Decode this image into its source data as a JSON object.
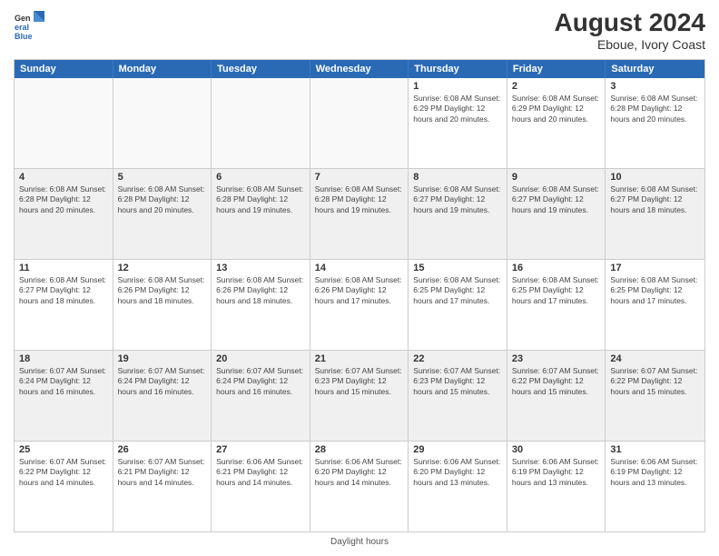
{
  "header": {
    "logo": {
      "general": "General",
      "blue": "Blue"
    },
    "title": "August 2024",
    "subtitle": "Eboue, Ivory Coast"
  },
  "calendar": {
    "days_of_week": [
      "Sunday",
      "Monday",
      "Tuesday",
      "Wednesday",
      "Thursday",
      "Friday",
      "Saturday"
    ],
    "weeks": [
      [
        {
          "day": "",
          "detail": "",
          "empty": true
        },
        {
          "day": "",
          "detail": "",
          "empty": true
        },
        {
          "day": "",
          "detail": "",
          "empty": true
        },
        {
          "day": "",
          "detail": "",
          "empty": true
        },
        {
          "day": "1",
          "detail": "Sunrise: 6:08 AM\nSunset: 6:29 PM\nDaylight: 12 hours\nand 20 minutes.",
          "empty": false
        },
        {
          "day": "2",
          "detail": "Sunrise: 6:08 AM\nSunset: 6:29 PM\nDaylight: 12 hours\nand 20 minutes.",
          "empty": false
        },
        {
          "day": "3",
          "detail": "Sunrise: 6:08 AM\nSunset: 6:28 PM\nDaylight: 12 hours\nand 20 minutes.",
          "empty": false
        }
      ],
      [
        {
          "day": "4",
          "detail": "Sunrise: 6:08 AM\nSunset: 6:28 PM\nDaylight: 12 hours\nand 20 minutes.",
          "empty": false
        },
        {
          "day": "5",
          "detail": "Sunrise: 6:08 AM\nSunset: 6:28 PM\nDaylight: 12 hours\nand 20 minutes.",
          "empty": false
        },
        {
          "day": "6",
          "detail": "Sunrise: 6:08 AM\nSunset: 6:28 PM\nDaylight: 12 hours\nand 19 minutes.",
          "empty": false
        },
        {
          "day": "7",
          "detail": "Sunrise: 6:08 AM\nSunset: 6:28 PM\nDaylight: 12 hours\nand 19 minutes.",
          "empty": false
        },
        {
          "day": "8",
          "detail": "Sunrise: 6:08 AM\nSunset: 6:27 PM\nDaylight: 12 hours\nand 19 minutes.",
          "empty": false
        },
        {
          "day": "9",
          "detail": "Sunrise: 6:08 AM\nSunset: 6:27 PM\nDaylight: 12 hours\nand 19 minutes.",
          "empty": false
        },
        {
          "day": "10",
          "detail": "Sunrise: 6:08 AM\nSunset: 6:27 PM\nDaylight: 12 hours\nand 18 minutes.",
          "empty": false
        }
      ],
      [
        {
          "day": "11",
          "detail": "Sunrise: 6:08 AM\nSunset: 6:27 PM\nDaylight: 12 hours\nand 18 minutes.",
          "empty": false
        },
        {
          "day": "12",
          "detail": "Sunrise: 6:08 AM\nSunset: 6:26 PM\nDaylight: 12 hours\nand 18 minutes.",
          "empty": false
        },
        {
          "day": "13",
          "detail": "Sunrise: 6:08 AM\nSunset: 6:26 PM\nDaylight: 12 hours\nand 18 minutes.",
          "empty": false
        },
        {
          "day": "14",
          "detail": "Sunrise: 6:08 AM\nSunset: 6:26 PM\nDaylight: 12 hours\nand 17 minutes.",
          "empty": false
        },
        {
          "day": "15",
          "detail": "Sunrise: 6:08 AM\nSunset: 6:25 PM\nDaylight: 12 hours\nand 17 minutes.",
          "empty": false
        },
        {
          "day": "16",
          "detail": "Sunrise: 6:08 AM\nSunset: 6:25 PM\nDaylight: 12 hours\nand 17 minutes.",
          "empty": false
        },
        {
          "day": "17",
          "detail": "Sunrise: 6:08 AM\nSunset: 6:25 PM\nDaylight: 12 hours\nand 17 minutes.",
          "empty": false
        }
      ],
      [
        {
          "day": "18",
          "detail": "Sunrise: 6:07 AM\nSunset: 6:24 PM\nDaylight: 12 hours\nand 16 minutes.",
          "empty": false
        },
        {
          "day": "19",
          "detail": "Sunrise: 6:07 AM\nSunset: 6:24 PM\nDaylight: 12 hours\nand 16 minutes.",
          "empty": false
        },
        {
          "day": "20",
          "detail": "Sunrise: 6:07 AM\nSunset: 6:24 PM\nDaylight: 12 hours\nand 16 minutes.",
          "empty": false
        },
        {
          "day": "21",
          "detail": "Sunrise: 6:07 AM\nSunset: 6:23 PM\nDaylight: 12 hours\nand 15 minutes.",
          "empty": false
        },
        {
          "day": "22",
          "detail": "Sunrise: 6:07 AM\nSunset: 6:23 PM\nDaylight: 12 hours\nand 15 minutes.",
          "empty": false
        },
        {
          "day": "23",
          "detail": "Sunrise: 6:07 AM\nSunset: 6:22 PM\nDaylight: 12 hours\nand 15 minutes.",
          "empty": false
        },
        {
          "day": "24",
          "detail": "Sunrise: 6:07 AM\nSunset: 6:22 PM\nDaylight: 12 hours\nand 15 minutes.",
          "empty": false
        }
      ],
      [
        {
          "day": "25",
          "detail": "Sunrise: 6:07 AM\nSunset: 6:22 PM\nDaylight: 12 hours\nand 14 minutes.",
          "empty": false
        },
        {
          "day": "26",
          "detail": "Sunrise: 6:07 AM\nSunset: 6:21 PM\nDaylight: 12 hours\nand 14 minutes.",
          "empty": false
        },
        {
          "day": "27",
          "detail": "Sunrise: 6:06 AM\nSunset: 6:21 PM\nDaylight: 12 hours\nand 14 minutes.",
          "empty": false
        },
        {
          "day": "28",
          "detail": "Sunrise: 6:06 AM\nSunset: 6:20 PM\nDaylight: 12 hours\nand 14 minutes.",
          "empty": false
        },
        {
          "day": "29",
          "detail": "Sunrise: 6:06 AM\nSunset: 6:20 PM\nDaylight: 12 hours\nand 13 minutes.",
          "empty": false
        },
        {
          "day": "30",
          "detail": "Sunrise: 6:06 AM\nSunset: 6:19 PM\nDaylight: 12 hours\nand 13 minutes.",
          "empty": false
        },
        {
          "day": "31",
          "detail": "Sunrise: 6:06 AM\nSunset: 6:19 PM\nDaylight: 12 hours\nand 13 minutes.",
          "empty": false
        }
      ]
    ]
  },
  "footer": {
    "text": "Daylight hours"
  }
}
